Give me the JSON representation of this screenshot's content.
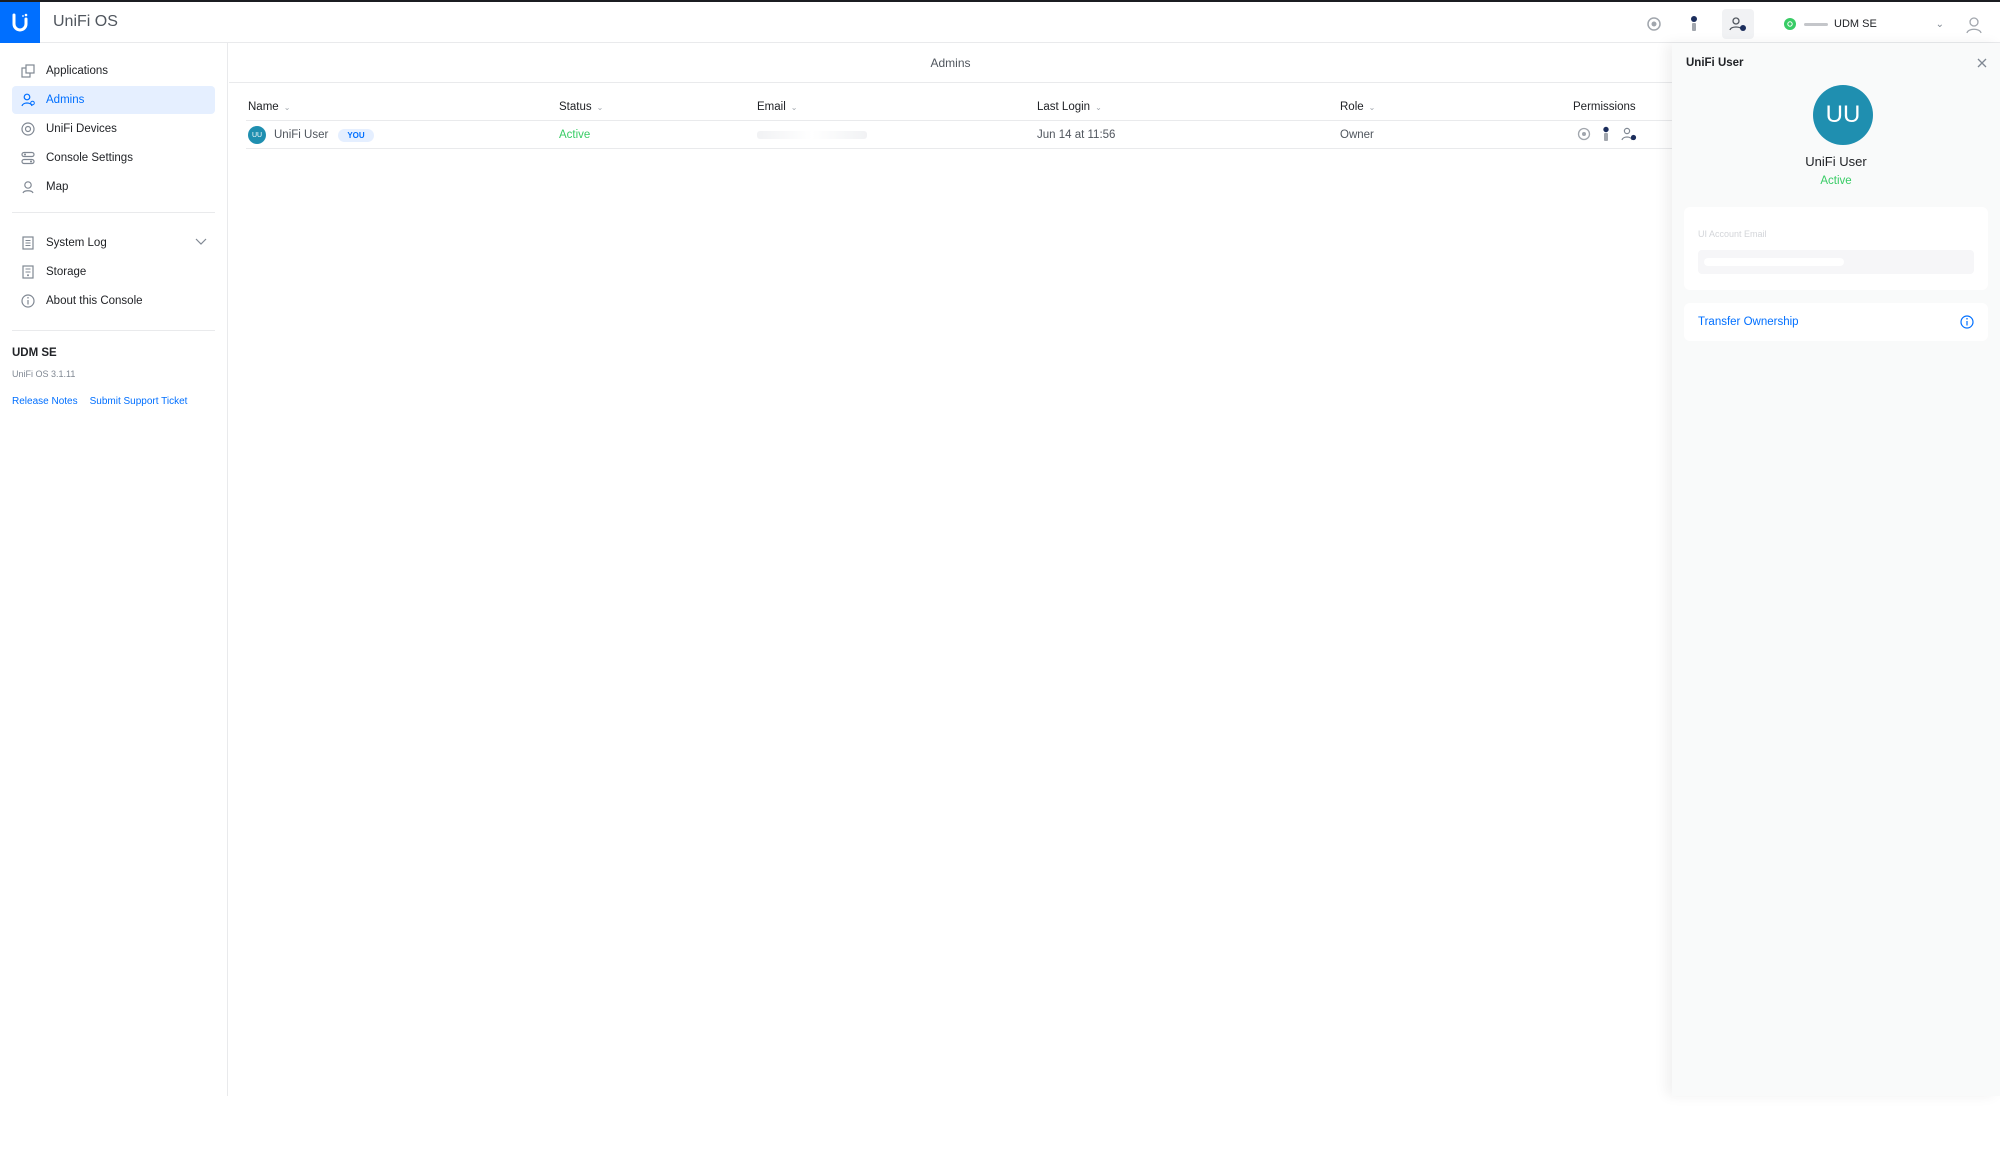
{
  "app": {
    "title": "UniFi OS"
  },
  "topbar": {
    "console_selector": {
      "label": "UDM SE"
    }
  },
  "sidebar": {
    "items": [
      {
        "label": "Applications",
        "icon": "applications-icon"
      },
      {
        "label": "Admins",
        "icon": "admins-icon",
        "selected": true
      },
      {
        "label": "UniFi Devices",
        "icon": "devices-icon"
      },
      {
        "label": "Console Settings",
        "icon": "settings-icon"
      },
      {
        "label": "Map",
        "icon": "map-icon"
      },
      {
        "label": "System Log",
        "icon": "log-icon",
        "expandable": true
      },
      {
        "label": "Storage",
        "icon": "storage-icon"
      },
      {
        "label": "About this Console",
        "icon": "info-icon"
      }
    ],
    "console": {
      "name": "UDM SE",
      "version": "UniFi OS 3.1.11"
    },
    "links": {
      "release_notes": "Release Notes",
      "support": "Submit Support Ticket"
    }
  },
  "main": {
    "header": "Admins",
    "columns": {
      "name": "Name",
      "status": "Status",
      "email": "Email",
      "last_login": "Last Login",
      "role": "Role",
      "permissions": "Permissions"
    },
    "rows": [
      {
        "initials": "UU",
        "name": "UniFi User",
        "badge": "YOU",
        "status": "Active",
        "last_login": "Jun 14 at 11:56",
        "role": "Owner"
      }
    ]
  },
  "panel": {
    "title": "UniFi User",
    "initials": "UU",
    "name": "UniFi User",
    "status": "Active",
    "email_label": "UI Account Email",
    "transfer_label": "Transfer Ownership"
  },
  "colors": {
    "accent": "#006fff",
    "active": "#38cc65",
    "avatar": "#1f8fb0"
  }
}
